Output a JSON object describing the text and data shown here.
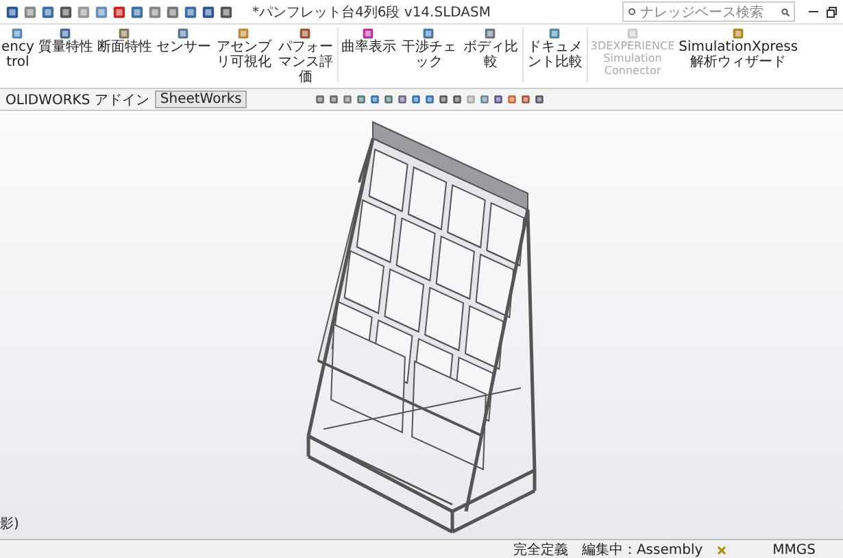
{
  "window": {
    "title": "*パンフレット台4列6段 v14.SLDASM"
  },
  "search": {
    "placeholder": "ナレッジベース検索"
  },
  "ribbon": {
    "buttons": [
      {
        "label": "ency\ntrol",
        "disabled": false
      },
      {
        "label": "質量特性",
        "disabled": false
      },
      {
        "label": "断面特性",
        "disabled": false
      },
      {
        "label": "センサー",
        "disabled": false
      },
      {
        "label": "アセンブリ可視化",
        "disabled": false
      },
      {
        "label": "パフォーマンス評価",
        "disabled": false
      },
      {
        "label": "曲率表示",
        "disabled": false
      },
      {
        "label": "干渉チェック",
        "disabled": false
      },
      {
        "label": "ボディ比較",
        "disabled": false
      },
      {
        "label": "ドキュメント比較",
        "disabled": false
      },
      {
        "label": "3DEXPERIENCE\nSimulation\nConnector",
        "disabled": true
      },
      {
        "label": "SimulationXpress\n解析ウィザード",
        "disabled": false
      }
    ]
  },
  "tabs": [
    {
      "label": "OLIDWORKS アドイン",
      "selected": false
    },
    {
      "label": "SheetWorks",
      "selected": true
    }
  ],
  "viewport": {
    "side_text": "影)"
  },
  "status_bar": {
    "items": [
      "完全定義",
      "編集中：Assembly",
      "MMGS"
    ]
  }
}
